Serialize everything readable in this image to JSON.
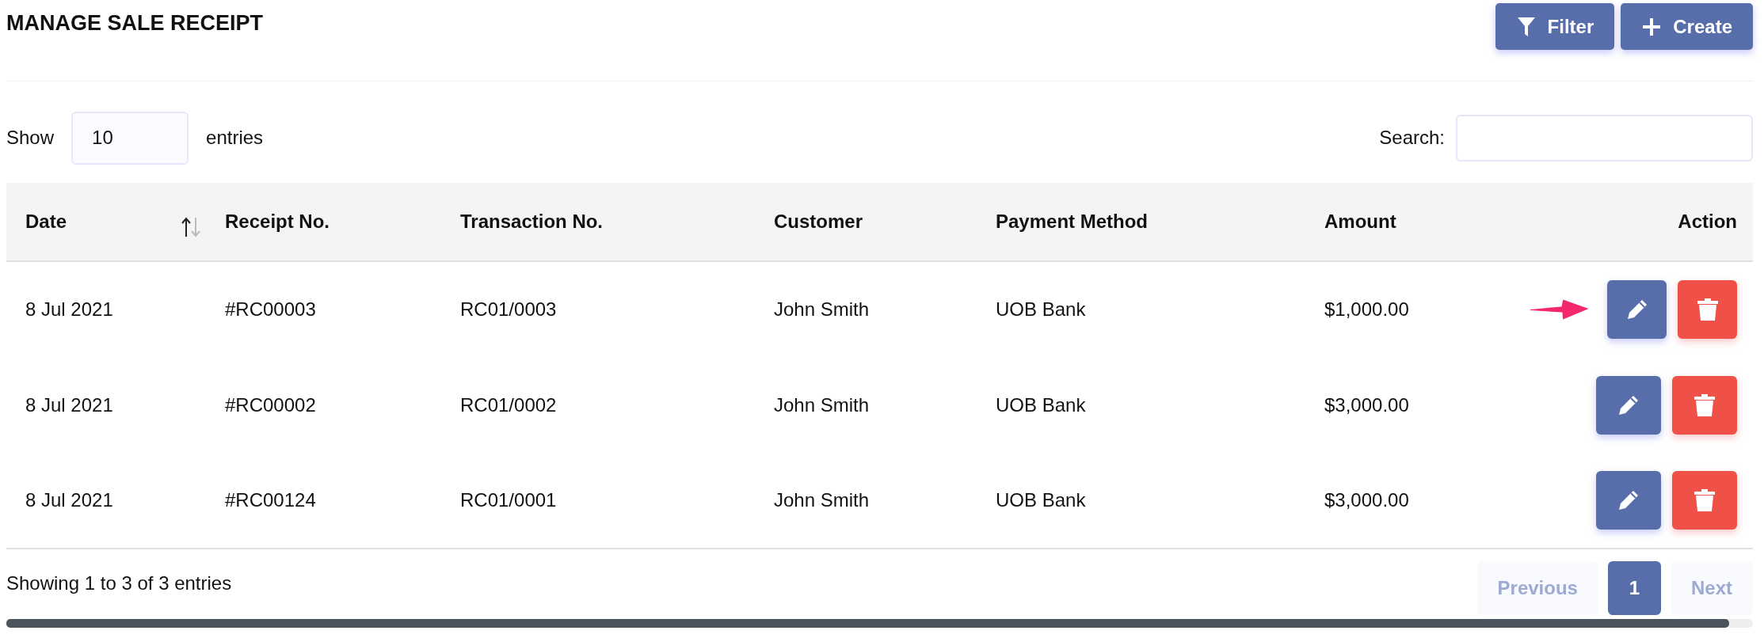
{
  "title": "MANAGE SALE RECEIPT",
  "header_buttons": [
    {
      "label": "Filter",
      "kind": "filter"
    },
    {
      "label": "Create",
      "kind": "create"
    }
  ],
  "length": {
    "before": "Show",
    "value": "10",
    "after": "entries"
  },
  "search": {
    "label": "Search:"
  },
  "table": {
    "columns": [
      {
        "label": "Date",
        "sortable": true
      },
      {
        "label": "Receipt No.",
        "sortable": false
      },
      {
        "label": "Transaction No.",
        "sortable": false
      },
      {
        "label": "Customer",
        "sortable": false
      },
      {
        "label": "Payment Method",
        "sortable": false
      },
      {
        "label": "Amount",
        "sortable": false
      },
      {
        "label": "Action",
        "sortable": false
      }
    ],
    "rows": [
      {
        "cells": [
          "8 Jul 2021",
          "#RC00003",
          "RC01/0003",
          "John Smith",
          "UOB Bank",
          "$1,000.00"
        ],
        "pointer": true
      },
      {
        "cells": [
          "8 Jul 2021",
          "#RC00002",
          "RC01/0002",
          "John Smith",
          "UOB Bank",
          "$3,000.00"
        ],
        "pointer": false
      },
      {
        "cells": [
          "8 Jul 2021",
          "#RC00124",
          "RC01/0001",
          "John Smith",
          "UOB Bank",
          "$3,000.00"
        ],
        "pointer": false
      }
    ]
  },
  "info": "Showing 1 to 3 of 3 entries",
  "pagination": {
    "previous": {
      "label": "Previous",
      "disabled": true
    },
    "pages": [
      {
        "label": "1",
        "selected": true
      }
    ],
    "next": {
      "label": "Next",
      "disabled": true
    }
  }
}
